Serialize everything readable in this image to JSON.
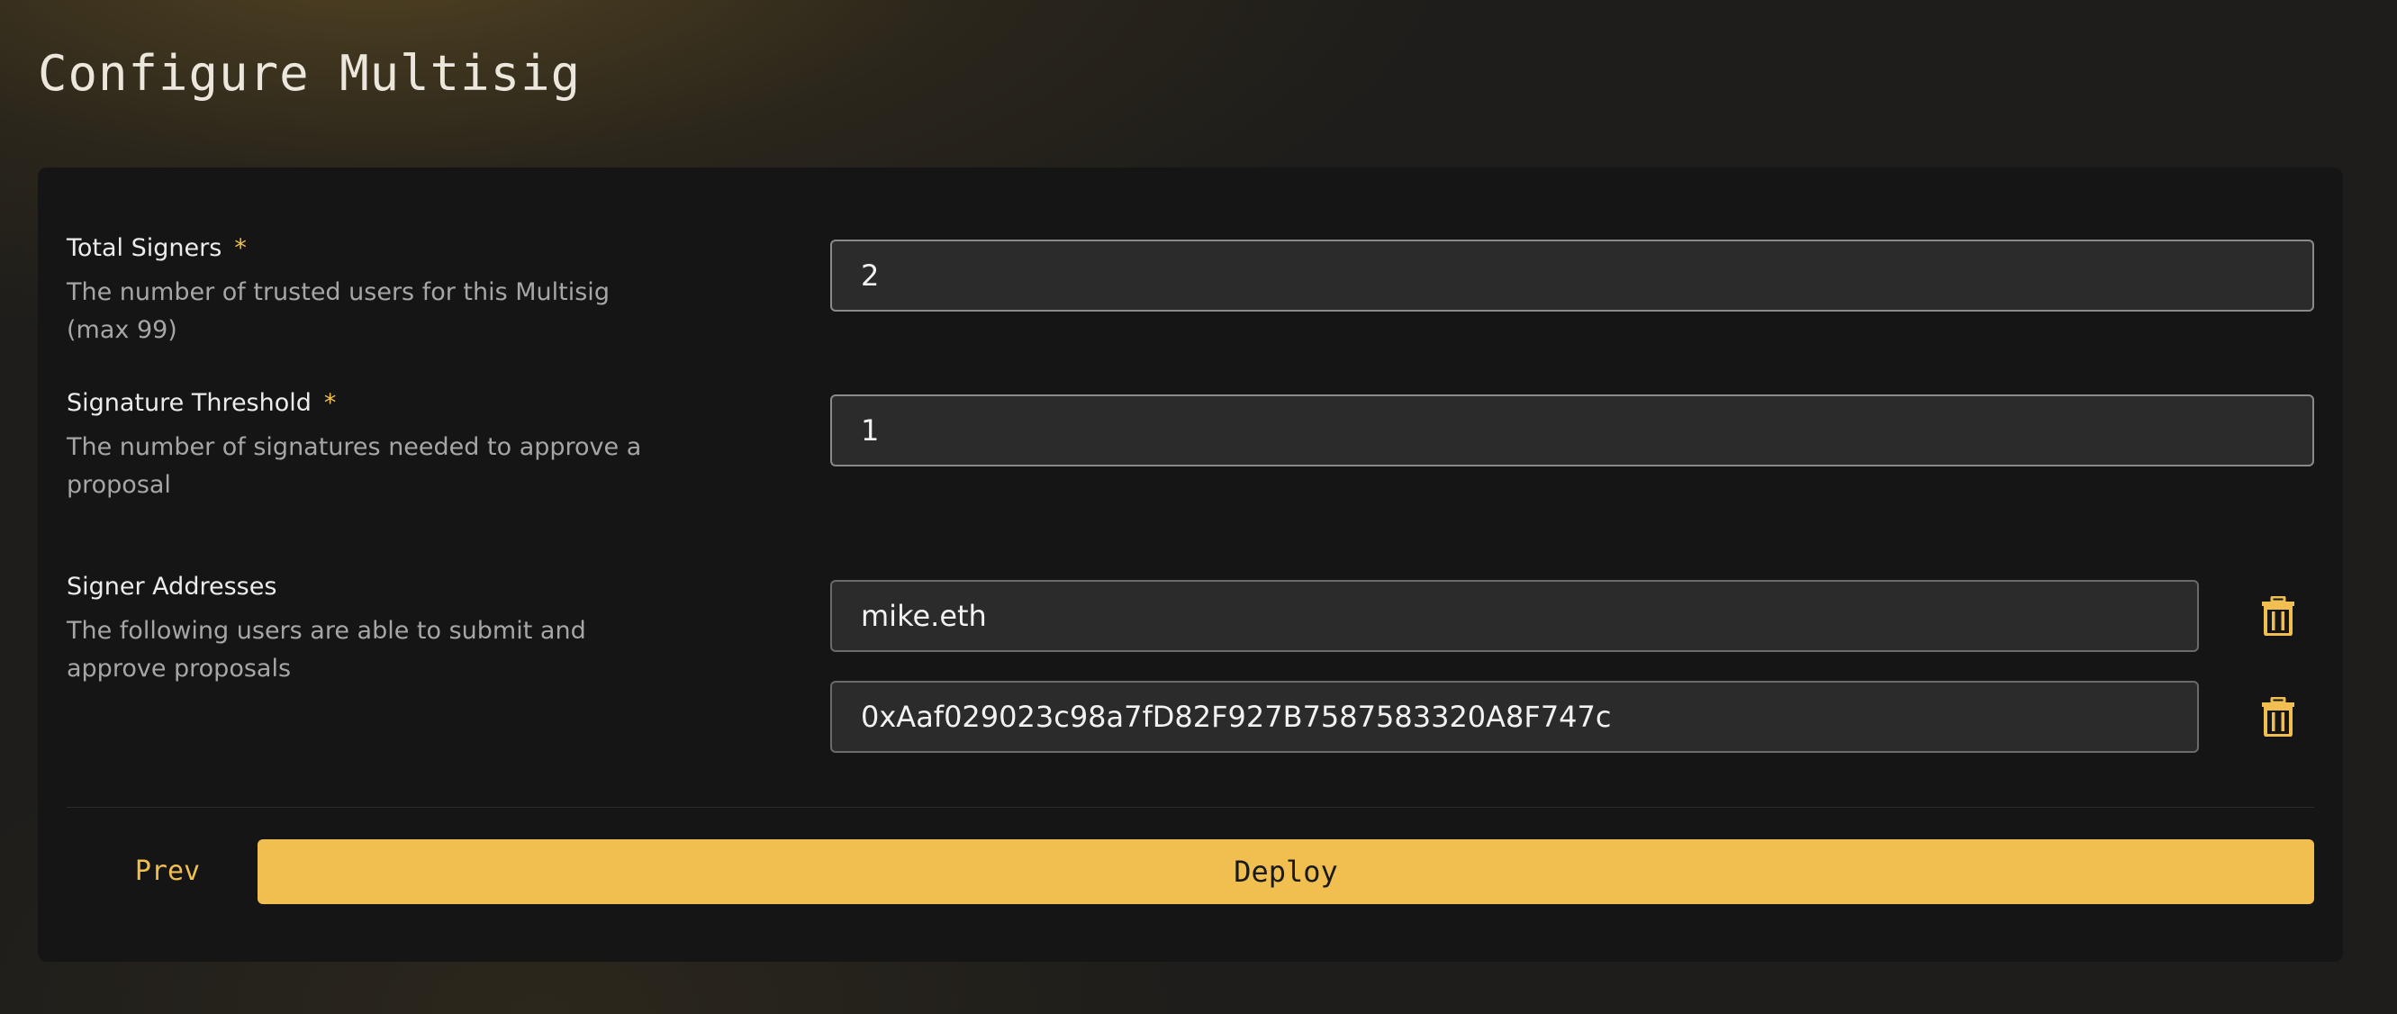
{
  "page": {
    "title": "Configure Multisig"
  },
  "form": {
    "total_signers": {
      "label": "Total Signers",
      "required_mark": "*",
      "description": "The number of trusted users for this Multisig (max 99)",
      "value": "2"
    },
    "signature_threshold": {
      "label": "Signature Threshold",
      "required_mark": "*",
      "description": "The number of signatures needed to approve a proposal",
      "value": "1"
    },
    "signer_addresses": {
      "label": "Signer Addresses",
      "description": "The following users are able to submit and approve proposals",
      "addresses": [
        "mike.eth",
        "0xAaf029023c98a7fD82F927B7587583320A8F747c"
      ],
      "remove_icon": "trash-icon"
    }
  },
  "actions": {
    "prev_label": "Prev",
    "deploy_label": "Deploy"
  },
  "colors": {
    "accent": "#f1bf50",
    "card_bg": "#151515",
    "input_bg": "#2b2b2b",
    "page_bg": "#1e1d1b"
  }
}
